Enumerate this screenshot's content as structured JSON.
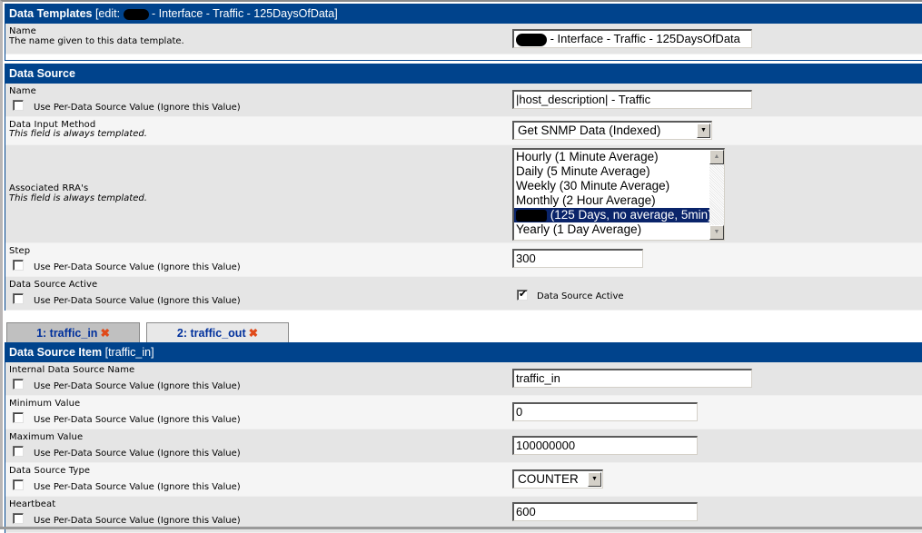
{
  "template_box": {
    "title": "Data Templates",
    "subtitle_prefix": "[edit: ",
    "subtitle_suffix": " - Interface - Traffic - 125DaysOfData]",
    "name_label": "Name",
    "name_desc": "The name given to this data template.",
    "name_value_suffix": " - Interface - Traffic - 125DaysOfData"
  },
  "data_source_box": {
    "title": "Data Source",
    "per_ds_label": "Use Per-Data Source Value (Ignore this Value)",
    "always_templated": "This field is always templated.",
    "name_label": "Name",
    "name_value": "|host_description| - Traffic",
    "input_method_label": "Data Input Method",
    "input_method_value": "Get SNMP Data (Indexed)",
    "rra_label": "Associated RRA's",
    "rra_options": [
      {
        "label": "Hourly (1 Minute Average)",
        "selected": false
      },
      {
        "label": "Daily (5 Minute Average)",
        "selected": false
      },
      {
        "label": "Weekly (30 Minute Average)",
        "selected": false
      },
      {
        "label": "Monthly (2 Hour Average)",
        "selected": false
      },
      {
        "label": " (125 Days, no average, 5min)",
        "selected": true
      },
      {
        "label": "Yearly (1 Day Average)",
        "selected": false
      }
    ],
    "step_label": "Step",
    "step_value": "300",
    "active_label": "Data Source Active",
    "active_checkbox_label": "Data Source Active",
    "active_checked": true
  },
  "tabs": [
    {
      "label": "1: traffic_in",
      "active": true
    },
    {
      "label": "2: traffic_out",
      "active": false
    }
  ],
  "item_box": {
    "title": "Data Source Item",
    "subtitle": "[traffic_in]",
    "per_ds_label": "Use Per-Data Source Value (Ignore this Value)",
    "internal_name_label": "Internal Data Source Name",
    "internal_name_value": "traffic_in",
    "min_label": "Minimum Value",
    "min_value": "0",
    "max_label": "Maximum Value",
    "max_value": "100000000",
    "type_label": "Data Source Type",
    "type_value": "COUNTER",
    "heartbeat_label": "Heartbeat",
    "heartbeat_value": "600"
  },
  "icons": {
    "tab_delete": "✖",
    "select_arrow": "▼",
    "scroll_up": "▲",
    "scroll_down": "▼"
  }
}
